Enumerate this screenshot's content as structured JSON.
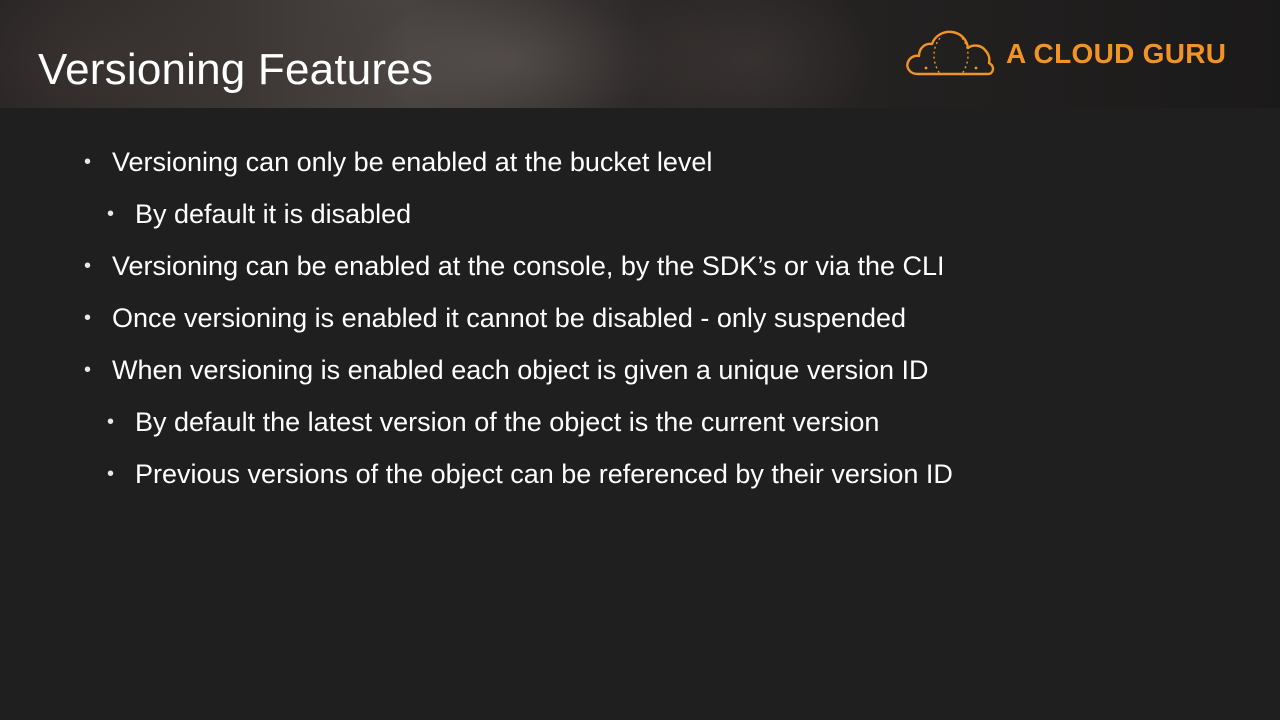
{
  "slide": {
    "title": "Versioning Features",
    "logo": {
      "text": "A CLOUD GURU",
      "icon": "cloud-icon",
      "color": "#f29424"
    },
    "bullet_glyph": "•",
    "bullets": [
      {
        "level": 1,
        "text": "Versioning can only be enabled at the bucket level"
      },
      {
        "level": 2,
        "text": "By default it is disabled"
      },
      {
        "level": 1,
        "text": "Versioning can be enabled at the console, by the SDK’s or via the CLI"
      },
      {
        "level": 1,
        "text": "Once versioning is enabled it cannot be disabled - only suspended"
      },
      {
        "level": 1,
        "text": "When versioning is enabled each object is given a unique version ID"
      },
      {
        "level": 2,
        "text": "By default the latest version of the object is the current version"
      },
      {
        "level": 2,
        "text": "Previous versions of the object can be referenced by their version ID"
      }
    ]
  }
}
